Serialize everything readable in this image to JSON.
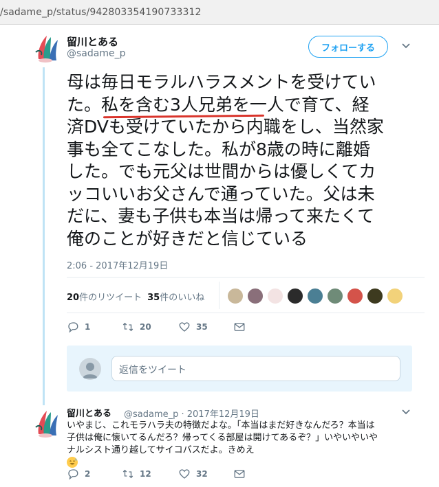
{
  "browser": {
    "url": "/sadame_p/status/942803354190733312"
  },
  "tweet": {
    "author_name": "留川とある",
    "author_handle": "@sadame_p",
    "follow_label": "フォローする",
    "lines": [
      "母は毎日モラルハラスメントを受けてい",
      "た。私を含む3人兄弟を一人で育て、経",
      "済DVも受けていたから内職をし、当然家",
      "事も全てこなした。私が8歳の時に離婚",
      "した。でも元父は世間からは優しくてカ",
      "ッコいいお父さんで通っていた。父は未",
      "だに、妻も子供も本当は帰って来たくて",
      "俺のことが好きだと信じている"
    ],
    "timestamp": "2:06 - 2017年12月19日",
    "retweet_count": "20",
    "retweet_label": "件のリツイート",
    "like_count": "35",
    "like_label": "件のいいね",
    "actions": {
      "reply": "1",
      "retweet": "20",
      "like": "35"
    },
    "reply_placeholder": "返信をツイート"
  },
  "reply": {
    "author_name": "留川とある",
    "meta": "@sadame_p · 2017年12月19日",
    "lines": [
      "いやまじ、これモラハラ夫の特徴だよな。「本当はまだ好きなんだろ？本当は",
      "子供は俺に懐いてるんだろ？帰ってくる部屋は開けてあるぞ？」いやいやいや",
      "ナルシスト通り越してサイコパスだよ。きめえ"
    ],
    "actions": {
      "reply": "2",
      "retweet": "12",
      "like": "32"
    }
  },
  "colors": {
    "accent": "#1da1f2",
    "annotation": "#d9342b",
    "muted": "#657786"
  }
}
